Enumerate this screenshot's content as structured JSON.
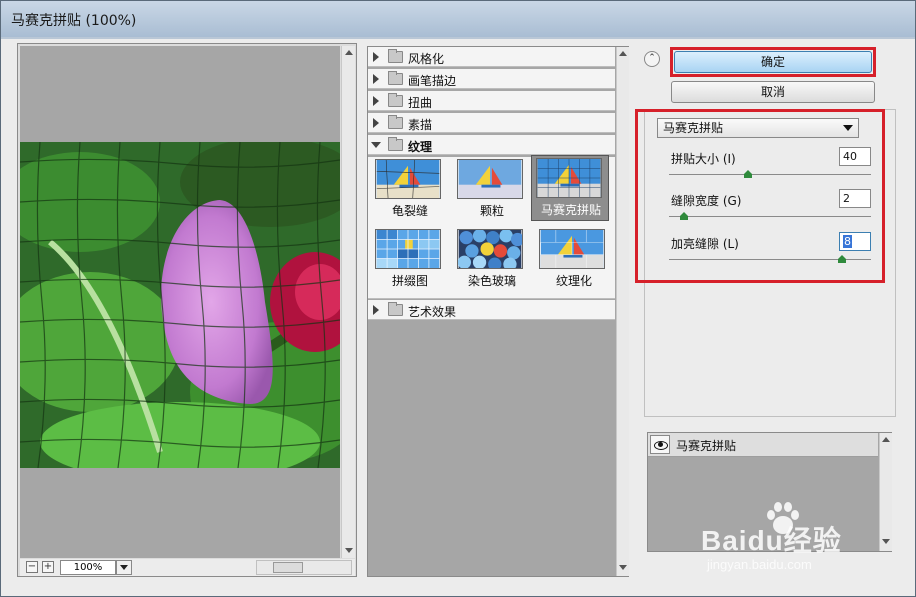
{
  "window": {
    "title": "马赛克拼贴 (100%)"
  },
  "preview": {
    "zoom": "100%",
    "minus": "−",
    "plus": "+"
  },
  "filter_tree": {
    "categories_top": [
      "风格化",
      "画笔描边",
      "扭曲",
      "素描"
    ],
    "open_category": "纹理",
    "thumbnails": [
      "龟裂缝",
      "颗粒",
      "马赛克拼贴",
      "拼缀图",
      "染色玻璃",
      "纹理化"
    ],
    "selected_thumbnail": "马赛克拼贴",
    "categories_bottom": [
      "艺术效果"
    ]
  },
  "buttons": {
    "ok": "确定",
    "cancel": "取消"
  },
  "settings": {
    "filter_select": "马赛克拼贴",
    "params": [
      {
        "label": "拼贴大小 (I)",
        "value": "40",
        "fraction": 0.39
      },
      {
        "label": "缝隙宽度 (G)",
        "value": "2",
        "fraction": 0.07
      },
      {
        "label": "加亮缝隙 (L)",
        "value": "8",
        "fraction": 0.86
      }
    ]
  },
  "layers": {
    "items": [
      "马赛克拼贴"
    ]
  },
  "watermark": {
    "text": "Baidu经验",
    "url": "jingyan.baidu.com"
  },
  "colors": {
    "highlight_outline": "#d6202a",
    "ok_button": "#a9d4f3",
    "slider_handle": "#2f8a3c"
  },
  "icons": [
    "collapse-icon",
    "folder-icon",
    "eye-icon",
    "expand-arrow-icon",
    "scroll-up-icon",
    "scroll-down-icon"
  ]
}
